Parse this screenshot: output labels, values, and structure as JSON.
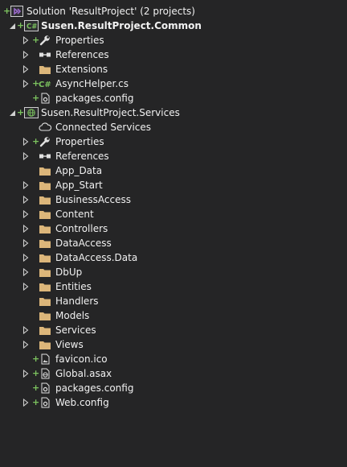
{
  "solution": {
    "label": "Solution 'ResultProject' (2 projects)"
  },
  "projects": [
    {
      "name": "Susen.ResultProject.Common",
      "items": [
        {
          "label": "Properties",
          "icon": "wrench-icon",
          "expand": "collapsed",
          "plus": true
        },
        {
          "label": "References",
          "icon": "references-icon",
          "expand": "collapsed",
          "plus": false
        },
        {
          "label": "Extensions",
          "icon": "folder-icon",
          "expand": "collapsed",
          "plus": false
        },
        {
          "label": "AsyncHelper.cs",
          "icon": "csharp-file-icon",
          "expand": "collapsed",
          "plus": true
        },
        {
          "label": "packages.config",
          "icon": "config-file-icon",
          "expand": "none",
          "plus": true
        }
      ]
    },
    {
      "name": "Susen.ResultProject.Services",
      "items": [
        {
          "label": "Connected Services",
          "icon": "connected-services-icon",
          "expand": "none",
          "plus": false
        },
        {
          "label": "Properties",
          "icon": "wrench-icon",
          "expand": "collapsed",
          "plus": true
        },
        {
          "label": "References",
          "icon": "references-icon",
          "expand": "collapsed",
          "plus": false
        },
        {
          "label": "App_Data",
          "icon": "folder-icon",
          "expand": "none",
          "plus": false
        },
        {
          "label": "App_Start",
          "icon": "folder-icon",
          "expand": "collapsed",
          "plus": false
        },
        {
          "label": "BusinessAccess",
          "icon": "folder-icon",
          "expand": "collapsed",
          "plus": false
        },
        {
          "label": "Content",
          "icon": "folder-icon",
          "expand": "collapsed",
          "plus": false
        },
        {
          "label": "Controllers",
          "icon": "folder-icon",
          "expand": "collapsed",
          "plus": false
        },
        {
          "label": "DataAccess",
          "icon": "folder-icon",
          "expand": "collapsed",
          "plus": false
        },
        {
          "label": "DataAccess.Data",
          "icon": "folder-icon",
          "expand": "collapsed",
          "plus": false
        },
        {
          "label": "DbUp",
          "icon": "folder-icon",
          "expand": "collapsed",
          "plus": false
        },
        {
          "label": "Entities",
          "icon": "folder-icon",
          "expand": "collapsed",
          "plus": false
        },
        {
          "label": "Handlers",
          "icon": "folder-icon",
          "expand": "none",
          "plus": false
        },
        {
          "label": "Models",
          "icon": "folder-icon",
          "expand": "none",
          "plus": false
        },
        {
          "label": "Services",
          "icon": "folder-icon",
          "expand": "collapsed",
          "plus": false
        },
        {
          "label": "Views",
          "icon": "folder-icon",
          "expand": "collapsed",
          "plus": false
        },
        {
          "label": "favicon.ico",
          "icon": "image-file-icon",
          "expand": "none",
          "plus": true
        },
        {
          "label": "Global.asax",
          "icon": "asax-file-icon",
          "expand": "collapsed",
          "plus": true
        },
        {
          "label": "packages.config",
          "icon": "config-file-icon",
          "expand": "none",
          "plus": true
        },
        {
          "label": "Web.config",
          "icon": "config-file-icon",
          "expand": "collapsed",
          "plus": true
        }
      ]
    }
  ],
  "colors": {
    "background": "#252526",
    "text": "#f1f1f1",
    "folder": "#dcb67a",
    "plus": "#7cc35f",
    "arrow": "#d0d0d0",
    "csharp": "#7cc35f",
    "solution": "#9b6bcc"
  }
}
